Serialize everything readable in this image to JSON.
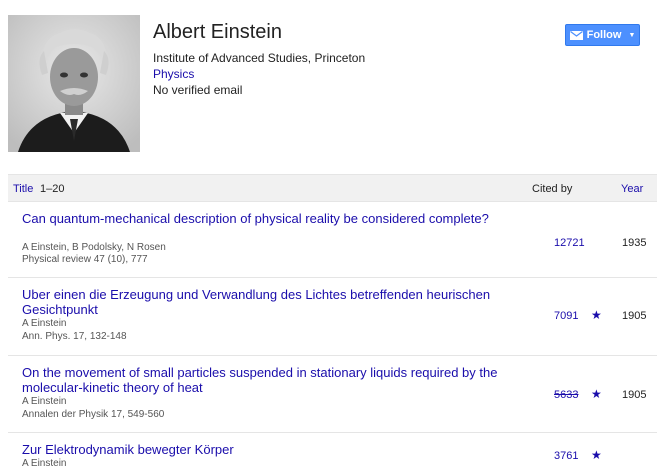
{
  "profile": {
    "name": "Albert Einstein",
    "affiliation": "Institute of Advanced Studies, Princeton",
    "field": "Physics",
    "email_status": "No verified email",
    "follow_label": "Follow",
    "follow_icon": "mail-icon",
    "follow_caret": "▼",
    "accent_color": "#4d90fe",
    "link_color": "#1a0dab"
  },
  "table": {
    "title_header": "Title",
    "range": "1–20",
    "cited_header": "Cited by",
    "year_header": "Year"
  },
  "articles": [
    {
      "title": "Can quantum-mechanical description of physical reality be considered complete?",
      "authors": "A Einstein, B Podolsky, N Rosen",
      "venue": "Physical review 47 (10), 777",
      "cited_by": "12721",
      "star": "",
      "year": "1935"
    },
    {
      "title": "Uber einen die Erzeugung und Verwandlung des Lichtes betreffenden heurischen Gesichtpunkt",
      "authors": "A Einstein",
      "venue": "Ann. Phys. 17, 132-148",
      "cited_by": "7091",
      "star": "★",
      "year": "1905"
    },
    {
      "title": "On the movement of small particles suspended in stationary liquids required by the molecular-kinetic theory of heat",
      "authors": "A Einstein",
      "venue": "Annalen der Physik 17, 549-560",
      "cited_by": "5633",
      "star": "★",
      "year": "1905"
    },
    {
      "title": "Zur Elektrodynamik bewegter Körper",
      "authors": "A Einstein",
      "venue": "",
      "cited_by": "3761",
      "star": "★",
      "year": ""
    }
  ]
}
